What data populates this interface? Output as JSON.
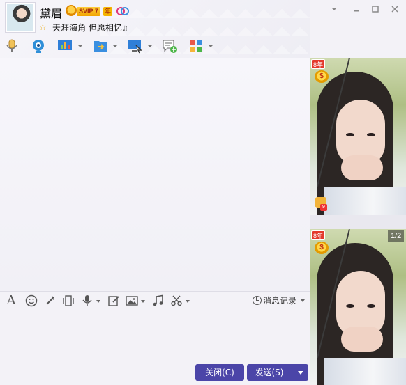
{
  "contact": {
    "nickname": "黛眉",
    "svip_label": "SVIP 7",
    "year_label": "年",
    "signature": "天涯海角 但愿相忆",
    "signature_suffix": "♫"
  },
  "icons": {
    "window_menu": "chevron-down-icon",
    "minimize": "minimize-icon",
    "maximize": "maximize-icon",
    "close": "close-icon",
    "voice_call": "microphone-icon",
    "video_call": "camera-icon",
    "screen_share": "screen-share-icon",
    "file_transfer": "file-transfer-icon",
    "remote_assist": "remote-desktop-icon",
    "group_chat": "new-chat-icon",
    "apps": "apps-icon",
    "font": "font-icon",
    "emoji": "emoji-icon",
    "nudge": "magic-wand-icon",
    "screenshot_shake": "vibrate-icon",
    "voice_message": "voice-message-icon",
    "edit": "edit-icon",
    "image": "image-icon",
    "music": "music-icon",
    "cut": "scissors-icon",
    "history": "clock-icon"
  },
  "input_toolbar": {
    "history_label": "消息记录"
  },
  "buttons": {
    "close_label": "关闭(C)",
    "send_label": "发送(S)"
  },
  "side_panel": {
    "badge_label": "8年",
    "coin_label": "$",
    "like_count": "9",
    "page_indicator": "1/2"
  },
  "colors": {
    "primary_button": "#4b45a8",
    "badge_gold": "#f2a400",
    "badge_red": "#e43a2c"
  }
}
